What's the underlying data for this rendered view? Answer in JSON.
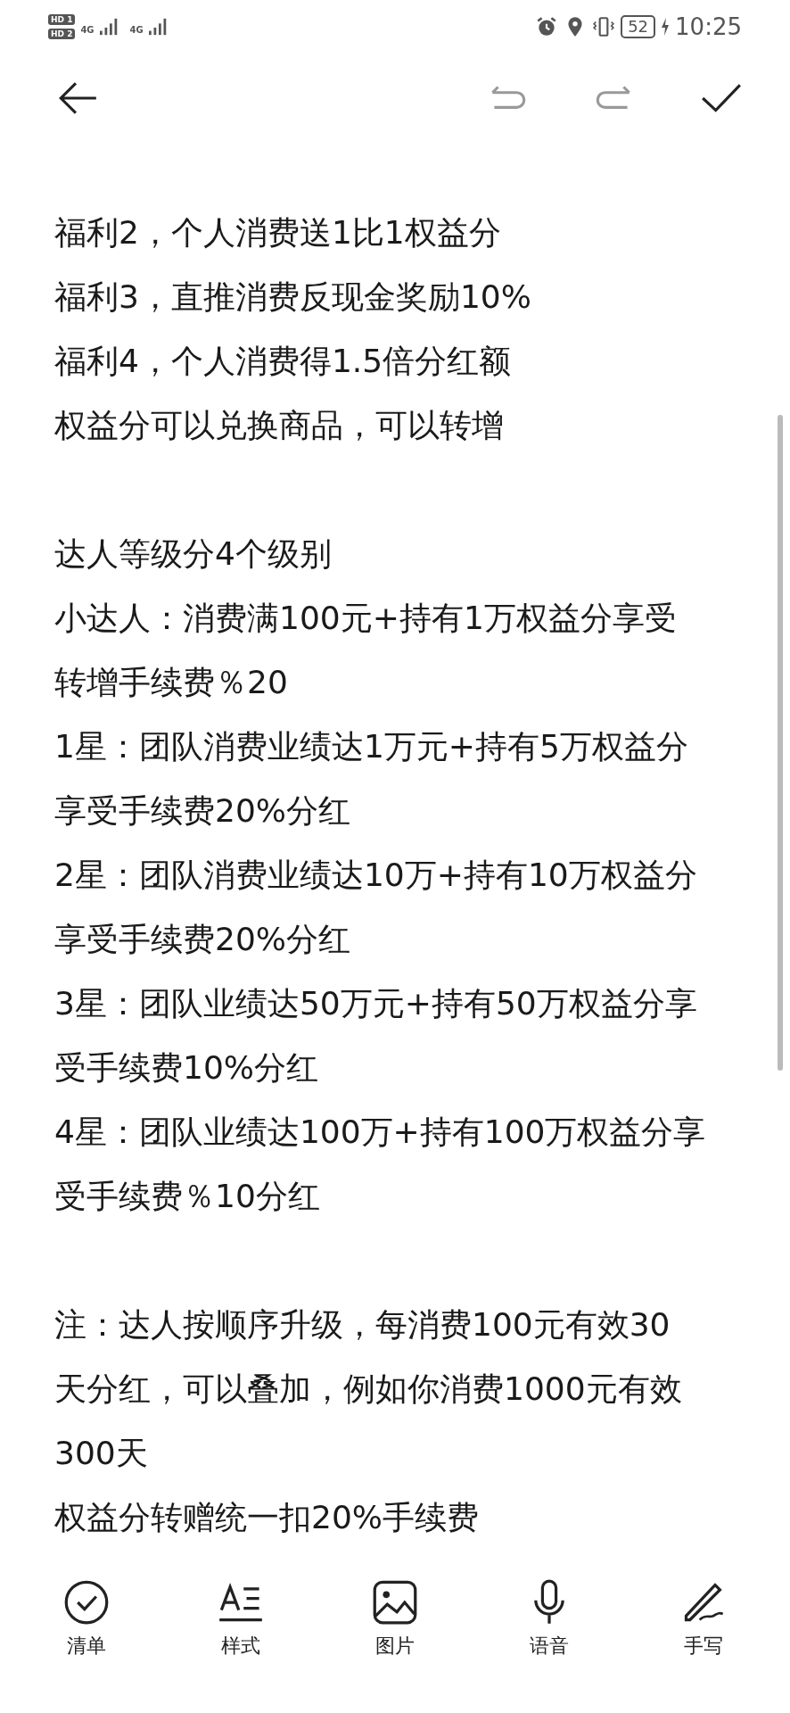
{
  "status_bar": {
    "sim_1": "HD 1",
    "sim_2": "HD 2",
    "network_1": "4G",
    "network_2": "4G",
    "battery": "52",
    "time": "10:25"
  },
  "paragraphs": [
    {
      "lines": [
        "福利2，个人消费送1比1权益分",
        "福利3，直推消费反现金奖励10%",
        "福利4，个人消费得1.5倍分红额",
        "权益分可以兑换商品，可以转增"
      ]
    },
    {
      "lines": [
        "达人等级分4个级别",
        "小达人：消费满100元+持有1万权益分享受",
        "转增手续费％20",
        "1星：团队消费业绩达1万元+持有5万权益分",
        "享受手续费20%分红",
        "2星：团队消费业绩达10万+持有10万权益分",
        "享受手续费20%分红",
        "3星：团队业绩达50万元+持有50万权益分享",
        "受手续费10%分红",
        "4星：团队业绩达100万+持有100万权益分享",
        "受手续费％10分红"
      ]
    },
    {
      "lines": [
        "注：达人按顺序升级，每消费100元有效30",
        "天分红，可以叠加，例如你消费1000元有效",
        "300天",
        "权益分转赠统一扣20%手续费"
      ]
    }
  ],
  "toolbar": [
    {
      "kind": "checklist",
      "label": "清单"
    },
    {
      "kind": "style",
      "label": "样式"
    },
    {
      "kind": "image",
      "label": "图片"
    },
    {
      "kind": "voice",
      "label": "语音"
    },
    {
      "kind": "handwriting",
      "label": "手写"
    }
  ]
}
